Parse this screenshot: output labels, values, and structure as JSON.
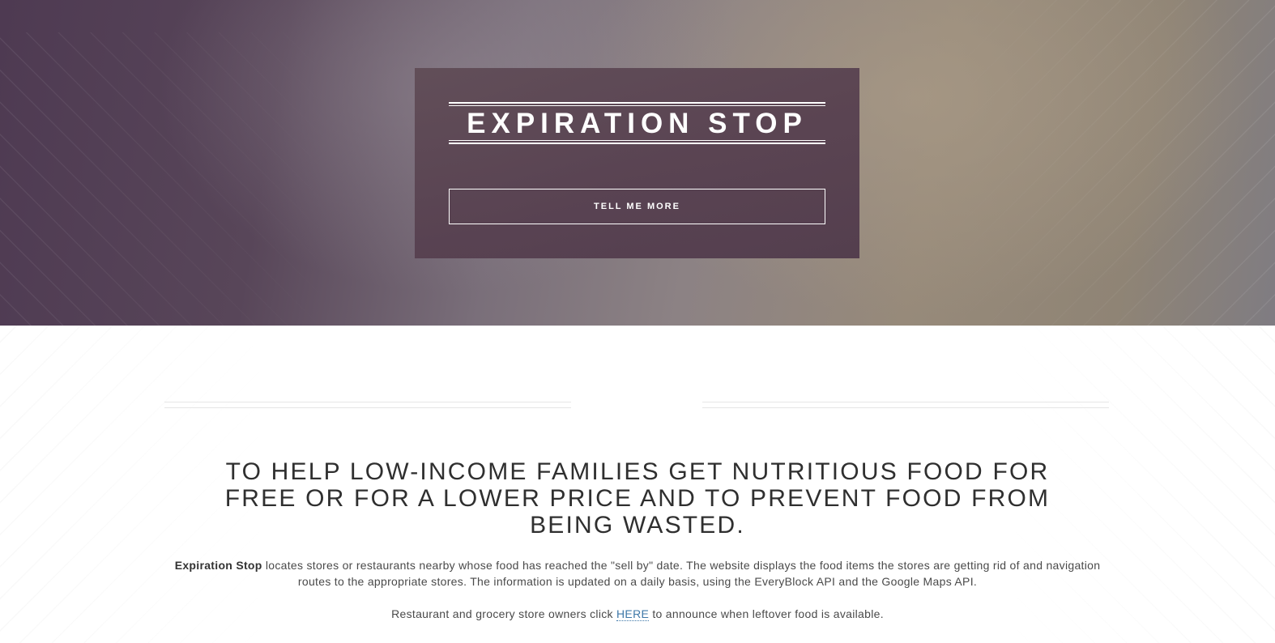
{
  "hero": {
    "title": "EXPIRATION STOP",
    "cta_label": "TELL ME MORE"
  },
  "about": {
    "mission": "TO HELP LOW-INCOME FAMILIES GET NUTRITIOUS FOOD FOR FREE OR FOR A LOWER PRICE AND TO PREVENT FOOD FROM BEING WASTED.",
    "brand_name": "Expiration Stop",
    "description": " locates stores or restaurants nearby whose food has reached the \"sell by\" date. The website displays the food items the stores are getting rid of and navigation routes to the appropriate stores. The information is updated on a daily basis, using the EveryBlock API and the Google Maps API.",
    "owners_prefix": "Restaurant and grocery store owners click ",
    "owners_link": "HERE",
    "owners_suffix": " to announce when leftover food is available."
  },
  "colors": {
    "hero_box": "#573f50",
    "link": "#3f78a8",
    "heading_text": "#2f2f2f",
    "body_text": "#4a4a4a"
  }
}
